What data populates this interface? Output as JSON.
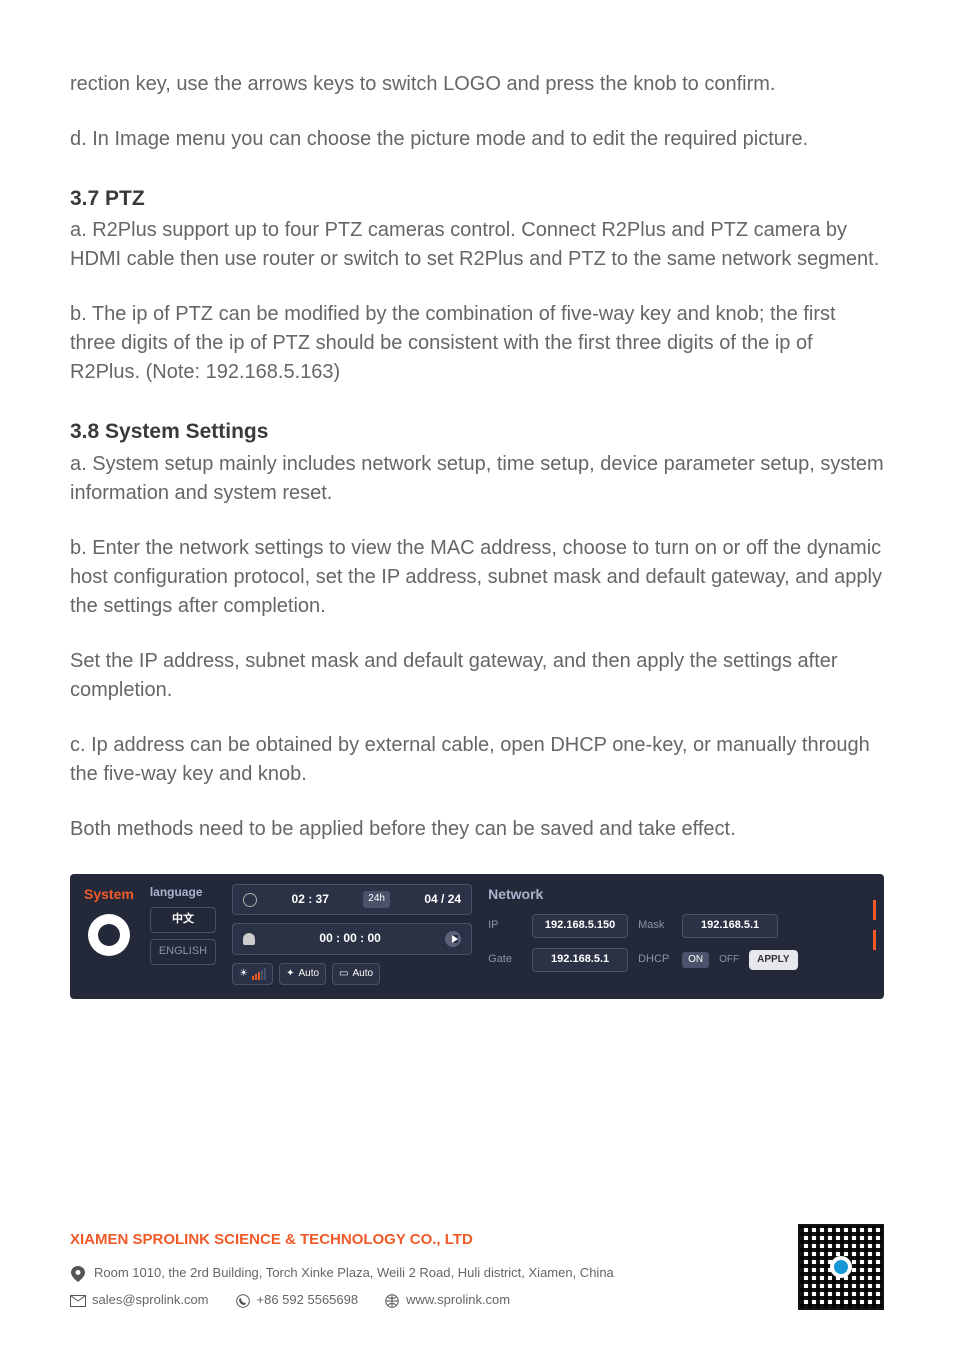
{
  "body": {
    "p0": "rection key, use the arrows keys to switch LOGO and press the knob to confirm.",
    "p1": "d. In Image menu you can choose the picture mode and to edit the required picture.",
    "s37_title": "3.7 PTZ",
    "s37_a": "a. R2Plus support up to four PTZ cameras control. Connect R2Plus and PTZ camera by HDMI cable then use router or switch to set R2Plus and PTZ to the same network segment.",
    "s37_b": "b. The ip of PTZ can be modified by the combination of five-way key and knob; the first three digits of the ip of PTZ should be consistent with the first three digits of the ip of R2Plus. (Note: 192.168.5.163)",
    "s38_title": "3.8 System Settings",
    "s38_a": "a. System setup mainly includes network setup, time setup, device parameter setup, system information and system reset.",
    "s38_b": "b. Enter the network settings to view the MAC address, choose to turn on or off the dynamic host configuration protocol, set the IP address, subnet mask and default gateway, and apply the settings after completion.",
    "s38_b2": "Set the IP address, subnet mask and default gateway, and then apply the settings after completion.",
    "s38_c": "c. Ip address can be obtained by external cable, open DHCP one-key, or manually through the five-way key and knob.",
    "s38_c2": "Both methods need to be applied before they can be saved and take effect."
  },
  "ui": {
    "system": "System",
    "language": "language",
    "lang_cn": "中文",
    "lang_en": "ENGLISH",
    "clock": "02 : 37",
    "tag24": "24h",
    "date": "04 / 24",
    "timer": "00 : 00 : 00",
    "auto1": "Auto",
    "auto2": "Auto",
    "network": "Network",
    "ip_label": "IP",
    "ip": "192.168.5.150",
    "mask_label": "Mask",
    "mask": "192.168.5.1",
    "gate_label": "Gate",
    "gate": "192.168.5.1",
    "dhcp_label": "DHCP",
    "on": "ON",
    "off": "OFF",
    "apply": "APPLY"
  },
  "footer": {
    "company": "XIAMEN SPROLINK SCIENCE & TECHNOLOGY CO., LTD",
    "address": "Room 1010, the 2rd Building, Torch Xinke Plaza, Weili 2 Road, Huli district, Xiamen, China",
    "email": "sales@sprolink.com",
    "phone": "+86 592 5565698",
    "web": "www.sprolink.com"
  }
}
